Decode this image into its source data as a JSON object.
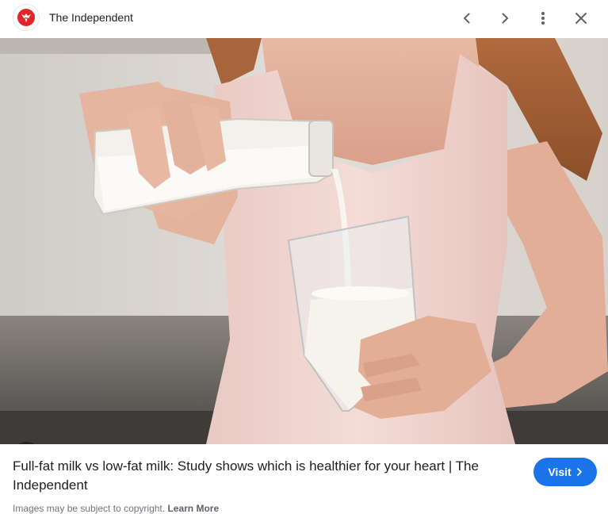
{
  "header": {
    "site_name": "The Independent",
    "logo_icon": "independent-eagle-logo",
    "back_icon": "chevron-left-icon",
    "forward_icon": "chevron-right-icon",
    "more_icon": "more-vert-icon",
    "close_icon": "close-icon",
    "logo_color": "#e3242b"
  },
  "image": {
    "lens_icon": "google-lens-icon"
  },
  "result": {
    "title": "Full-fat milk vs low-fat milk: Study shows which is healthier for your heart | The Independent",
    "visit_label": "Visit",
    "accent_color": "#1a73e8"
  },
  "footer": {
    "copyright_text": "Images may be subject to copyright.",
    "learn_more_label": "Learn More"
  }
}
